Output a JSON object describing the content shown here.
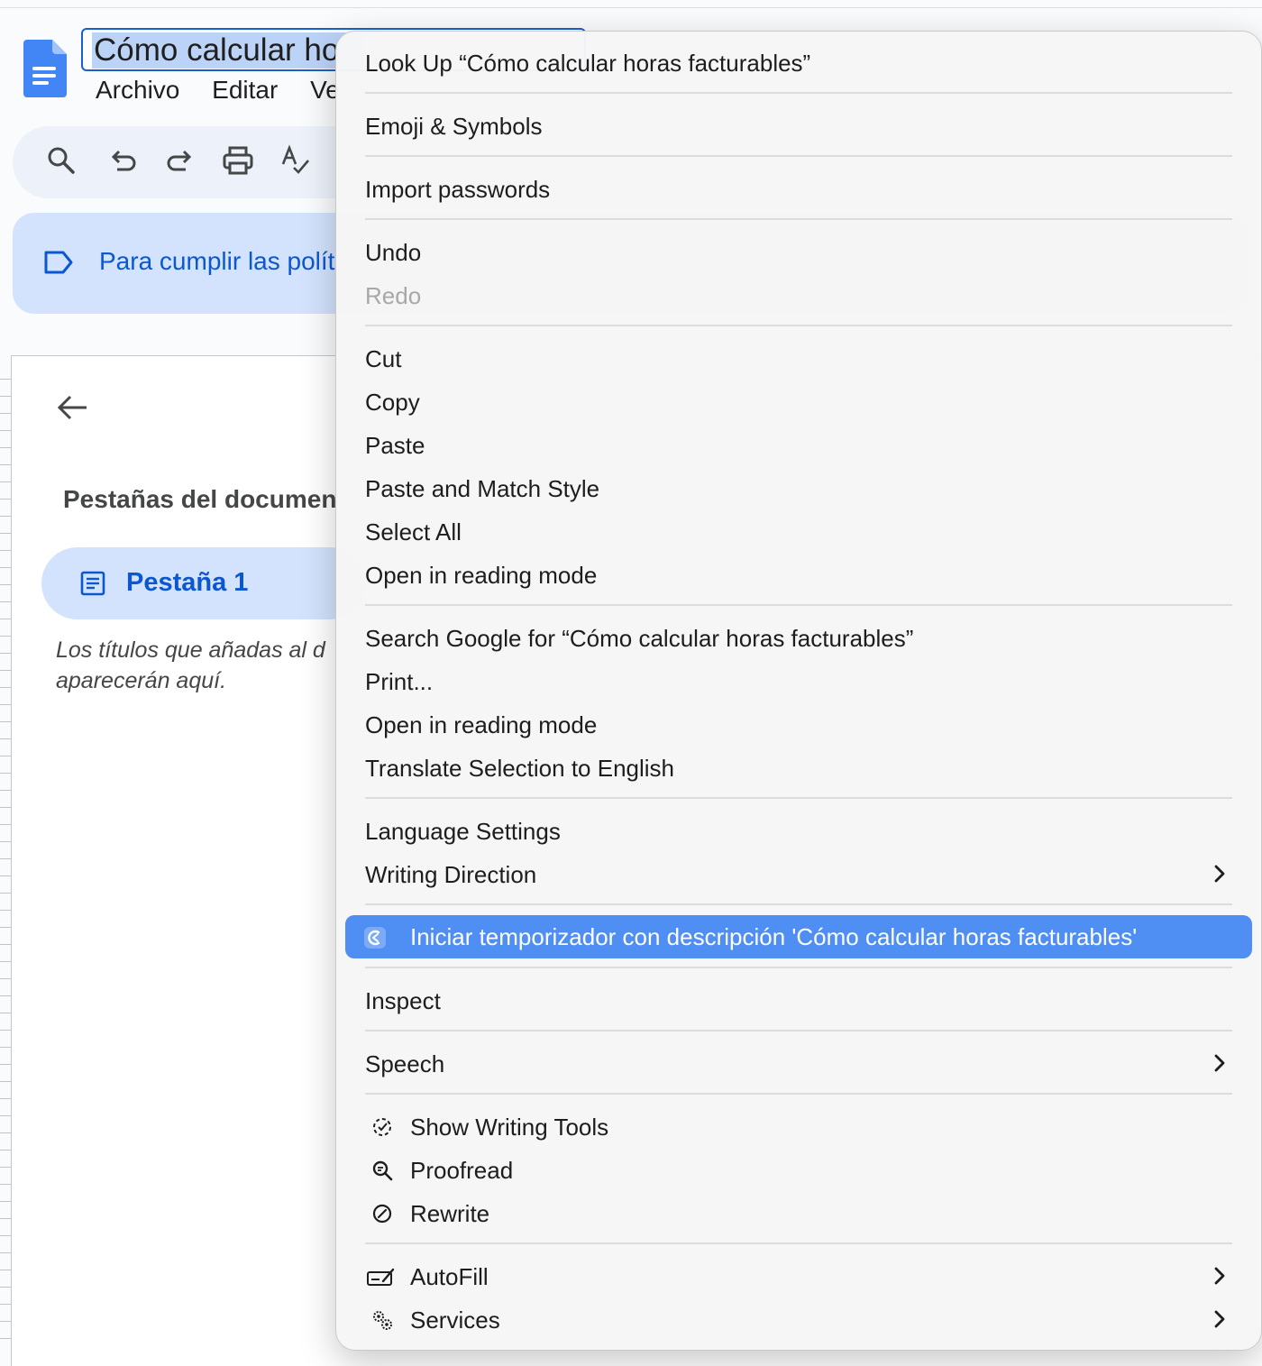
{
  "document": {
    "title": "Cómo calcular ho",
    "menu": [
      "Archivo",
      "Editar",
      "Ve"
    ],
    "banner_text": "Para cumplir las polít",
    "tabs_heading": "Pestañas del documen",
    "tab_label": "Pestaña 1",
    "hint_line1": "Los títulos que añadas al d",
    "hint_line2": "aparecerán aquí."
  },
  "context_menu": {
    "look_up": "Look Up “Cómo calcular horas facturables”",
    "emoji": "Emoji & Symbols",
    "import_passwords": "Import passwords",
    "undo": "Undo",
    "redo": "Redo",
    "cut": "Cut",
    "copy": "Copy",
    "paste": "Paste",
    "paste_match": "Paste and Match Style",
    "select_all": "Select All",
    "open_reading_1": "Open in reading mode",
    "search_google": "Search Google for “Cómo calcular horas facturables”",
    "print": "Print...",
    "open_reading_2": "Open in reading mode",
    "translate": "Translate Selection to English",
    "language_settings": "Language Settings",
    "writing_direction": "Writing Direction",
    "start_timer": "Iniciar temporizador con descripción 'Cómo calcular horas facturables'",
    "inspect": "Inspect",
    "speech": "Speech",
    "writing_tools": "Show Writing Tools",
    "proofread": "Proofread",
    "rewrite": "Rewrite",
    "autofill": "AutoFill",
    "services": "Services"
  },
  "colors": {
    "highlight": "#4f8ef3",
    "docs_blue": "#0b57d0",
    "banner_bg": "#d3e3fd"
  },
  "icons": [
    "docs-logo-icon",
    "search-icon",
    "undo-icon",
    "redo-icon",
    "print-icon",
    "spellcheck-icon",
    "label-icon",
    "back-arrow-icon",
    "document-tab-icon",
    "timer-app-icon",
    "writing-tools-icon",
    "proofread-icon",
    "rewrite-icon",
    "autofill-icon",
    "services-icon",
    "chevron-right-icon"
  ]
}
